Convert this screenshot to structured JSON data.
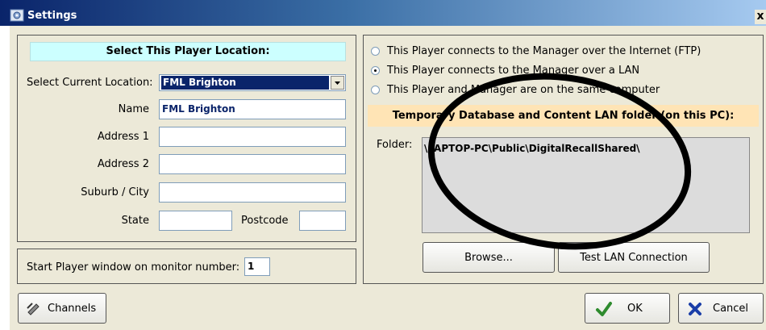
{
  "window": {
    "title": "Settings",
    "close_glyph": "x"
  },
  "location_panel": {
    "header": "Select This Player Location:",
    "select_label": "Select Current Location:",
    "select_value": "FML Brighton",
    "fields": {
      "name": {
        "label": "Name",
        "value": "FML Brighton"
      },
      "address1": {
        "label": "Address 1",
        "value": ""
      },
      "address2": {
        "label": "Address 2",
        "value": ""
      },
      "suburb": {
        "label": "Suburb / City",
        "value": ""
      },
      "state": {
        "label": "State",
        "value": ""
      },
      "postcode": {
        "label": "Postcode",
        "value": ""
      }
    }
  },
  "monitor_panel": {
    "label": "Start Player window on monitor number:",
    "value": "1"
  },
  "connection_panel": {
    "options": [
      {
        "label": "This Player connects to the Manager over the Internet (FTP)",
        "selected": false
      },
      {
        "label": "This Player connects to the Manager over a LAN",
        "selected": true
      },
      {
        "label": "This Player and Manager are on the same computer",
        "selected": false
      }
    ],
    "folder_header": "Temporary Database and Content LAN folder (on this PC):",
    "folder_label": "Folder:",
    "folder_value": "\\LAPTOP-PC\\Public\\DigitalRecallShared\\",
    "browse_label": "Browse...",
    "test_label": "Test LAN Connection"
  },
  "footer": {
    "channels_label": "Channels",
    "ok_label": "OK",
    "cancel_label": "Cancel"
  },
  "colors": {
    "header_cyan": "#ccffff",
    "header_peach": "#ffe4b5",
    "selection": "#0a246a",
    "annotation": "#000000"
  },
  "icons": [
    "settings-gear-icon",
    "channels-pen-icon",
    "ok-check-icon",
    "cancel-x-icon"
  ]
}
